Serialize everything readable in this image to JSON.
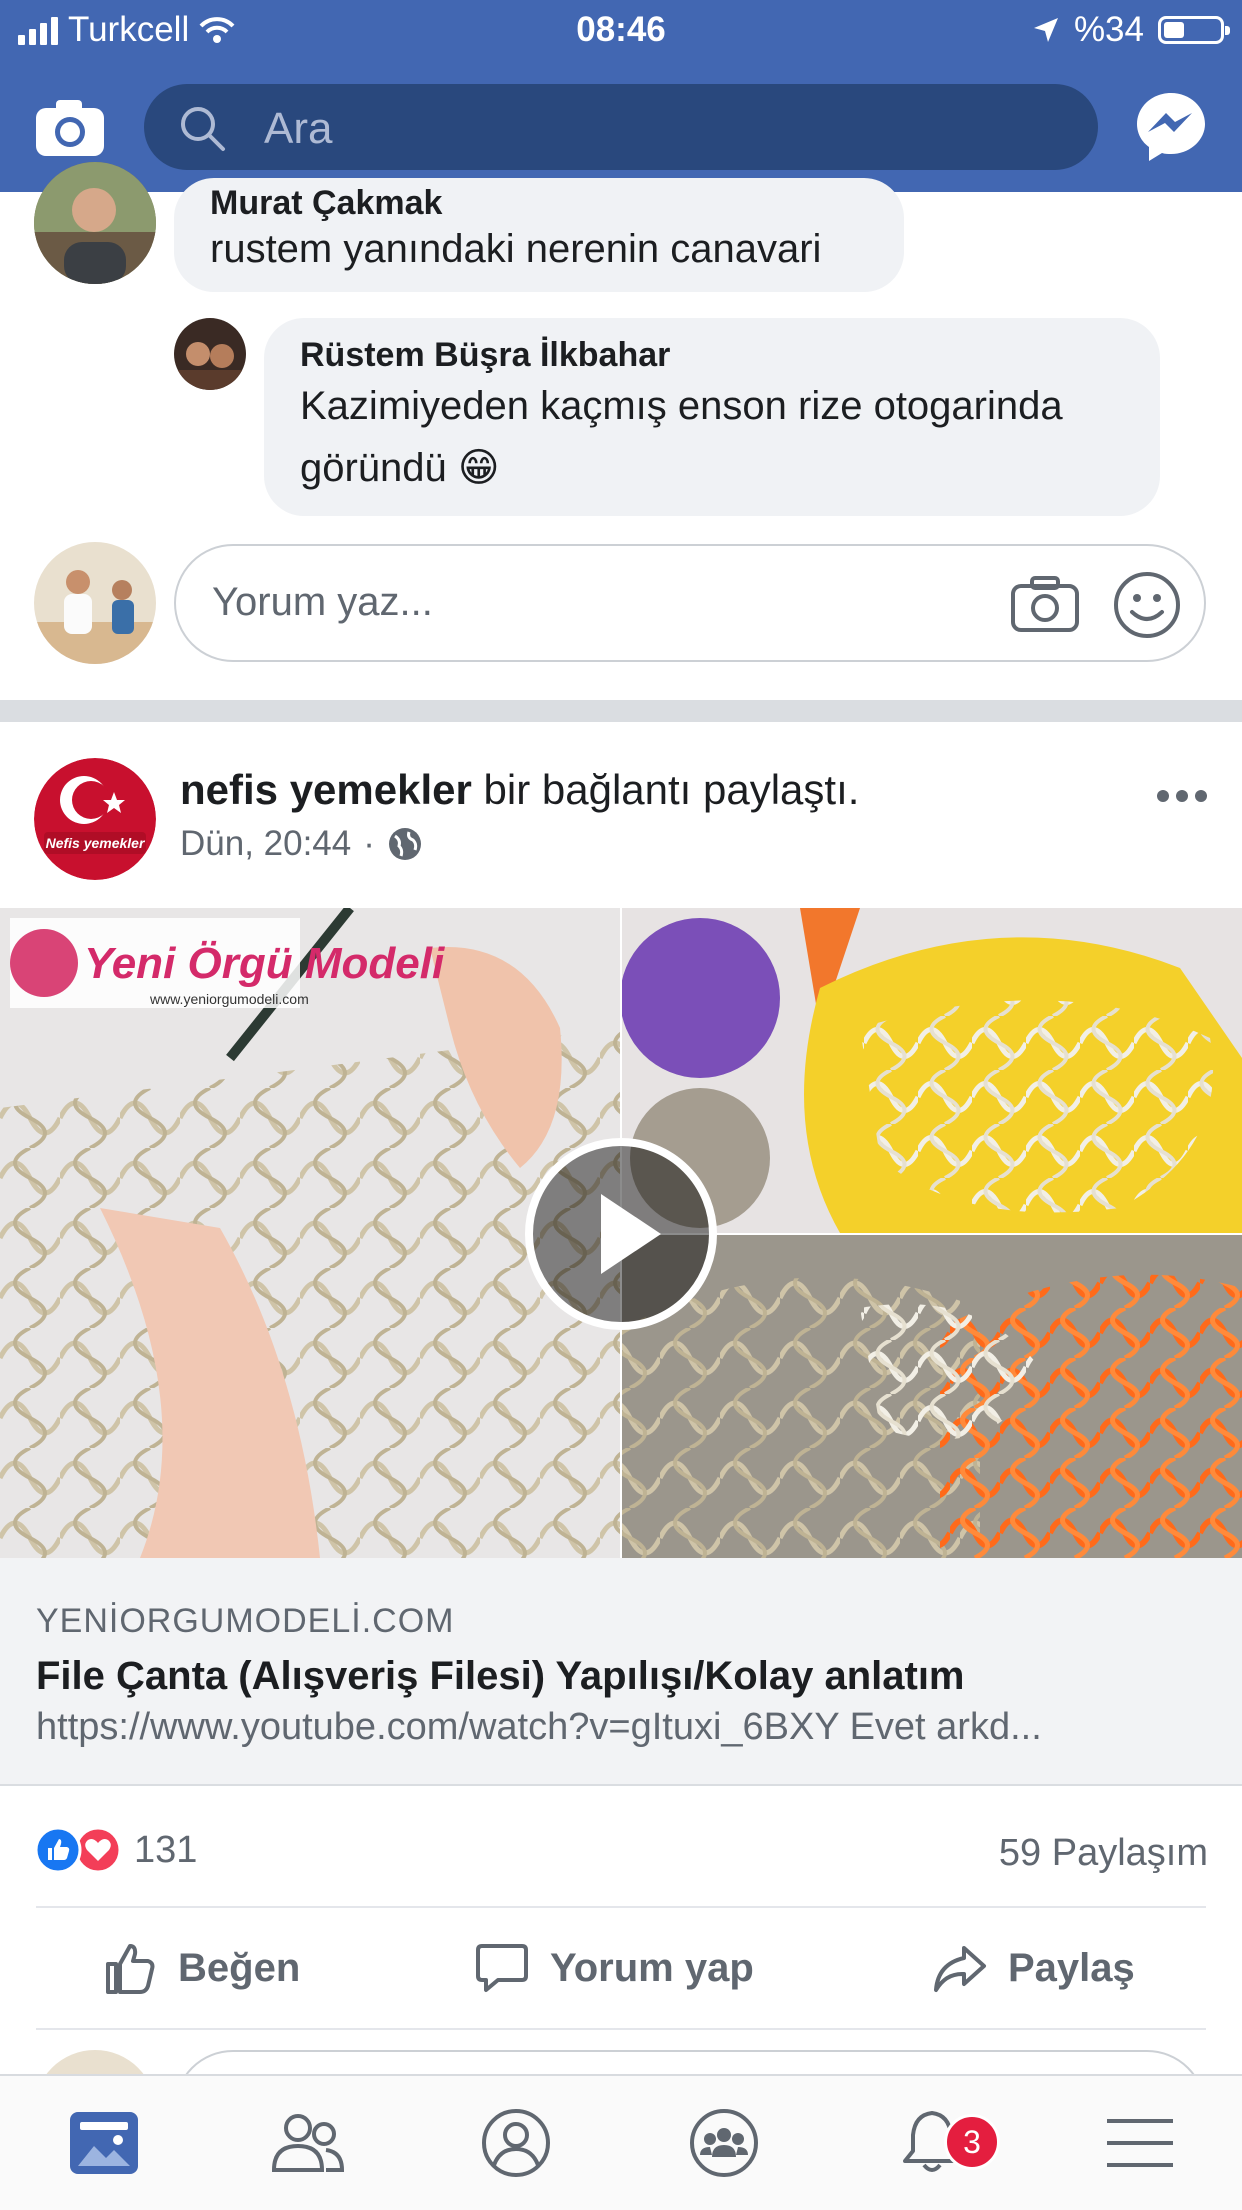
{
  "status_bar": {
    "carrier": "Turkcell",
    "time": "08:46",
    "battery": "%34"
  },
  "header": {
    "search_placeholder": "Ara"
  },
  "comments": [
    {
      "author": "Murat Çakmak",
      "text": "rustem yanındaki nerenin canavari"
    },
    {
      "author": "Rüstem Büşra İlkbahar",
      "text_line1": "Kazimiyeden kaçmış enson rize otogarinda",
      "text_line2": "göründü",
      "emoji": "😁"
    }
  ],
  "comment_input": {
    "placeholder": "Yorum yaz..."
  },
  "post": {
    "author": "nefis yemekler",
    "action": "bir bağlantı paylaştı.",
    "time": "Dün, 20:44",
    "separator": "·",
    "avatar_text": "Nefis yemekler",
    "video_watermark": "Yeni Örgü Modeli",
    "video_watermark_url": "www.yeniorgumodeli.com",
    "link": {
      "domain": "YENİORGUMODELİ.COM",
      "title": "File Çanta (Alışveriş Filesi) Yapılışı/Kolay anlatım",
      "description": "https://www.youtube.com/watch?v=gItuxi_6BXY Evet arkd..."
    },
    "reactions_count": "131",
    "shares": "59 Paylaşım",
    "actions": {
      "like": "Beğen",
      "comment": "Yorum yap",
      "share": "Paylaş"
    }
  },
  "tabbar": {
    "notifications_badge": "3"
  },
  "colors": {
    "brand": "#4267b2",
    "like": "#1877f2",
    "love": "#f33e58",
    "badge": "#e41e3f"
  }
}
